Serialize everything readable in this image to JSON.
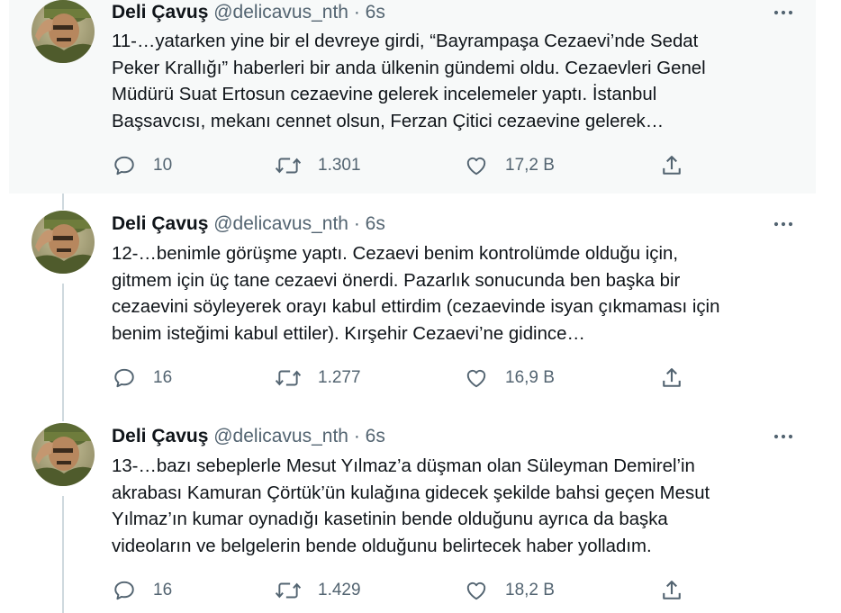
{
  "author": {
    "name": "Deli Çavuş",
    "handle": "@delicavus_nth"
  },
  "separator": "·",
  "icons": {
    "more": "more-horizontal-icon",
    "reply": "reply-icon",
    "retweet": "retweet-icon",
    "like": "heart-icon",
    "share": "share-icon"
  },
  "colors": {
    "text_primary": "#0f1419",
    "text_secondary": "#536471",
    "thread_line": "#cfd9de",
    "hover_bg": "#f7f9f9"
  },
  "tweets": [
    {
      "time": "6s",
      "lines": [
        "11-…yatarken yine bir el devreye girdi, “Bayrampaşa Cezaevi’nde Sedat",
        "Peker Krallığı” haberleri bir anda ülkenin gündemi oldu. Cezaevleri Genel",
        "Müdürü Suat Ertosun cezaevine gelerek incelemeler yaptı. İstanbul",
        "Başsavcısı, mekanı cennet olsun, Ferzan Çitici cezaevine gelerek…"
      ],
      "replies": "10",
      "retweets": "1.301",
      "likes": "17,2 B"
    },
    {
      "time": "6s",
      "lines": [
        "12-…benimle görüşme yaptı. Cezaevi benim kontrolümde olduğu için,",
        "gitmem için üç tane cezaevi önerdi. Pazarlık sonucunda ben başka bir",
        "cezaevini söyleyerek orayı kabul ettirdim (cezaevinde isyan çıkmaması için",
        "benim isteğimi kabul ettiler). Kırşehir Cezaevi’ne gidince…"
      ],
      "replies": "16",
      "retweets": "1.277",
      "likes": "16,9 B"
    },
    {
      "time": "6s",
      "lines": [
        "13-…bazı sebeplerle Mesut Yılmaz’a düşman olan Süleyman Demirel’in",
        "akrabası Kamuran Çörtük’ün kulağına gidecek şekilde bahsi geçen Mesut",
        "Yılmaz’ın kumar oynadığı kasetinin bende olduğunu ayrıca da başka",
        "videoların ve belgelerin bende olduğunu belirtecek haber yolladım."
      ],
      "replies": "16",
      "retweets": "1.429",
      "likes": "18,2 B"
    }
  ]
}
